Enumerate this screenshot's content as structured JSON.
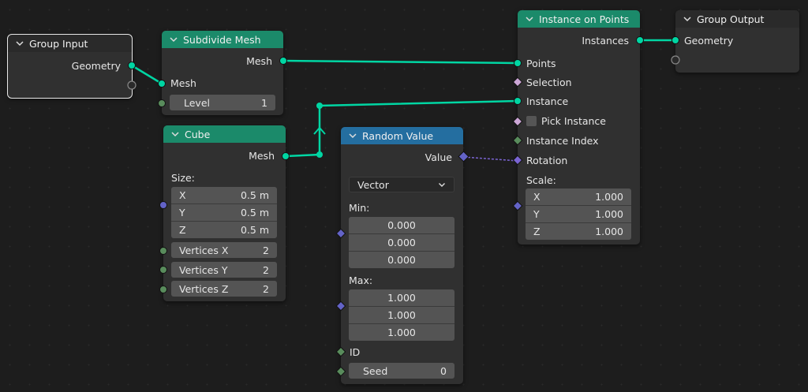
{
  "colors": {
    "geometry": "#00d6a3",
    "int": "#598c5c",
    "vector": "#6363c7",
    "bool": "#cca6d6",
    "rotation": "#a663c7",
    "header_geometry": "#1b8a6a",
    "header_utility": "#246ea0"
  },
  "group_input": {
    "title": "Group Input",
    "out_geometry": "Geometry"
  },
  "subdivide": {
    "title": "Subdivide Mesh",
    "out_mesh": "Mesh",
    "in_mesh": "Mesh",
    "level_label": "Level",
    "level_value": "1"
  },
  "cube": {
    "title": "Cube",
    "out_mesh": "Mesh",
    "size_label": "Size:",
    "size": [
      {
        "axis": "X",
        "value": "0.5 m"
      },
      {
        "axis": "Y",
        "value": "0.5 m"
      },
      {
        "axis": "Z",
        "value": "0.5 m"
      }
    ],
    "vx_label": "Vertices X",
    "vx_value": "2",
    "vy_label": "Vertices Y",
    "vy_value": "2",
    "vz_label": "Vertices Z",
    "vz_value": "2"
  },
  "random": {
    "title": "Random Value",
    "out_value": "Value",
    "type": "Vector",
    "min_label": "Min:",
    "min": [
      "0.000",
      "0.000",
      "0.000"
    ],
    "max_label": "Max:",
    "max": [
      "1.000",
      "1.000",
      "1.000"
    ],
    "id_label": "ID",
    "seed_label": "Seed",
    "seed_value": "0"
  },
  "instance": {
    "title": "Instance on Points",
    "out_instances": "Instances",
    "points": "Points",
    "selection": "Selection",
    "instance": "Instance",
    "pick_instance": "Pick Instance",
    "instance_index": "Instance Index",
    "rotation": "Rotation",
    "scale_label": "Scale:",
    "scale": [
      {
        "axis": "X",
        "value": "1.000"
      },
      {
        "axis": "Y",
        "value": "1.000"
      },
      {
        "axis": "Z",
        "value": "1.000"
      }
    ]
  },
  "group_output": {
    "title": "Group Output",
    "in_geometry": "Geometry"
  }
}
